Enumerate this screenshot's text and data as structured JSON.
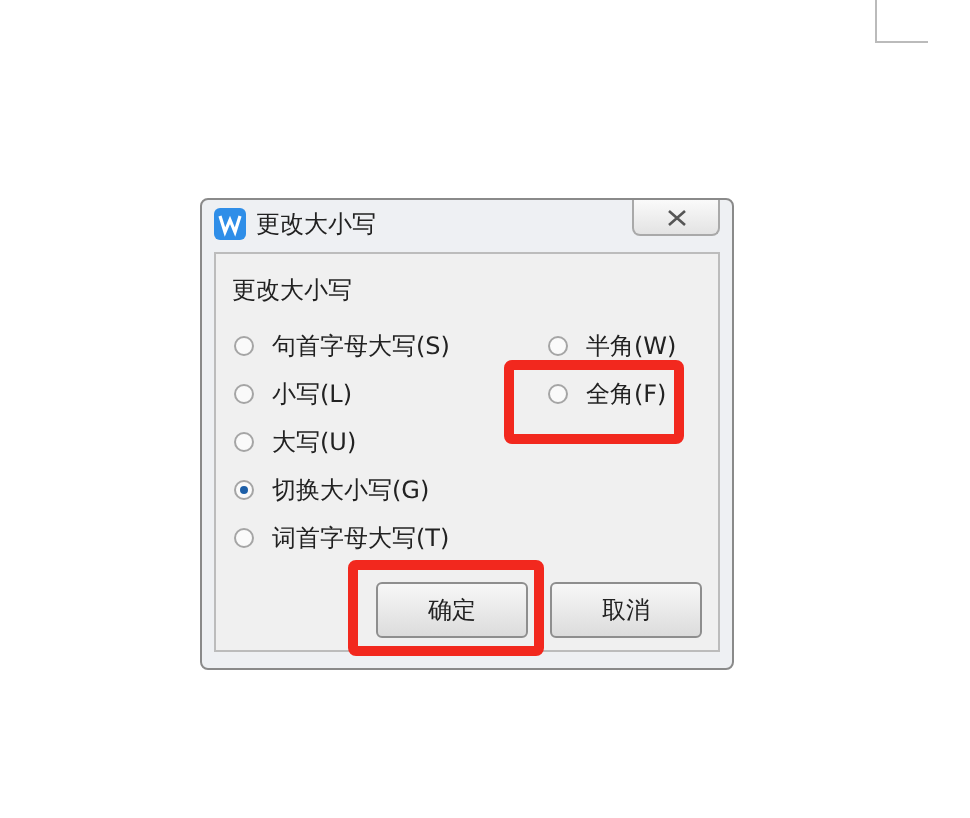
{
  "dialog": {
    "title": "更改大小写",
    "group_label": "更改大小写",
    "left_options": [
      {
        "label": "句首字母大写(S)",
        "selected": false
      },
      {
        "label": "小写(L)",
        "selected": false
      },
      {
        "label": "大写(U)",
        "selected": false
      },
      {
        "label": "切换大小写(G)",
        "selected": true
      },
      {
        "label": "词首字母大写(T)",
        "selected": false
      }
    ],
    "right_options": [
      {
        "label": "半角(W)",
        "selected": false,
        "highlighted": false
      },
      {
        "label": "全角(F)",
        "selected": false,
        "highlighted": true
      }
    ],
    "buttons": [
      {
        "label": "确定",
        "highlighted": true
      },
      {
        "label": "取消",
        "highlighted": false
      }
    ]
  }
}
